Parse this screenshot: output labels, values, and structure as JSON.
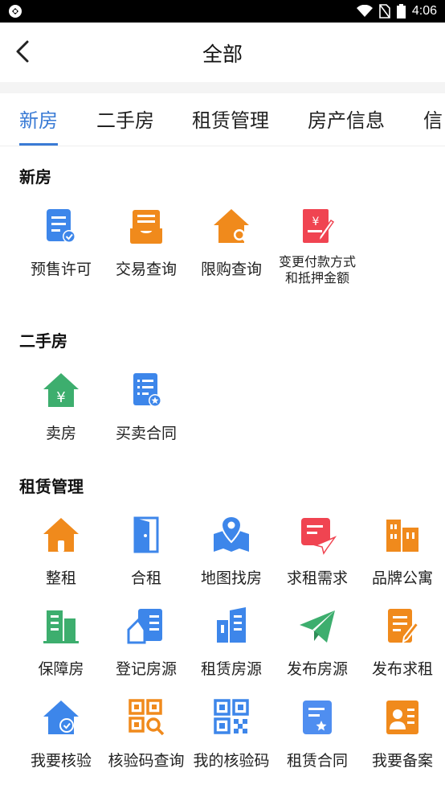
{
  "status_bar": {
    "time": "4:06"
  },
  "header": {
    "title": "全部"
  },
  "tabs": [
    "新房",
    "二手房",
    "租赁管理",
    "房产信息",
    "信"
  ],
  "sections": [
    {
      "title": "新房",
      "items": [
        {
          "label": "预售许可",
          "icon": "document-check-icon",
          "color": "#3d86ea"
        },
        {
          "label": "交易查询",
          "icon": "inbox-list-icon",
          "color": "#f08a1c"
        },
        {
          "label": "限购查询",
          "icon": "house-search-icon",
          "color": "#f08a1c"
        },
        {
          "label_line1": "变更付款方式",
          "label_line2": "和抵押金额",
          "icon": "yuan-document-edit-icon",
          "color": "#f04451"
        }
      ]
    },
    {
      "title": "二手房",
      "items": [
        {
          "label": "卖房",
          "icon": "house-yuan-icon",
          "color": "#3dae6e"
        },
        {
          "label": "买卖合同",
          "icon": "contract-star-icon",
          "color": "#3d86ea"
        }
      ]
    },
    {
      "title": "租赁管理",
      "items": [
        {
          "label": "整租",
          "icon": "house-icon",
          "color": "#f08a1c"
        },
        {
          "label": "合租",
          "icon": "door-icon",
          "color": "#3d86ea"
        },
        {
          "label": "地图找房",
          "icon": "map-pin-icon",
          "color": "#3d86ea"
        },
        {
          "label": "求租需求",
          "icon": "message-send-icon",
          "color": "#f04451"
        },
        {
          "label": "品牌公寓",
          "icon": "apartment-building-icon",
          "color": "#f08a1c"
        },
        {
          "label": "保障房",
          "icon": "buildings-icon",
          "color": "#3dae6e"
        },
        {
          "label": "登记房源",
          "icon": "register-house-icon",
          "color": "#3d86ea"
        },
        {
          "label": "租赁房源",
          "icon": "rental-buildings-icon",
          "color": "#3d86ea"
        },
        {
          "label": "发布房源",
          "icon": "paper-plane-icon",
          "color": "#3dae6e"
        },
        {
          "label": "发布求租",
          "icon": "document-edit-icon",
          "color": "#f08a1c"
        },
        {
          "label": "我要核验",
          "icon": "house-check-icon",
          "color": "#3d86ea"
        },
        {
          "label": "核验码查询",
          "icon": "qr-search-icon",
          "color": "#f08a1c"
        },
        {
          "label": "我的核验码",
          "icon": "qr-code-icon",
          "color": "#3d86ea"
        },
        {
          "label": "租赁合同",
          "icon": "contract-icon",
          "color": "#3d86ea"
        },
        {
          "label": "我要备案",
          "icon": "contact-card-icon",
          "color": "#f08a1c"
        }
      ]
    }
  ]
}
